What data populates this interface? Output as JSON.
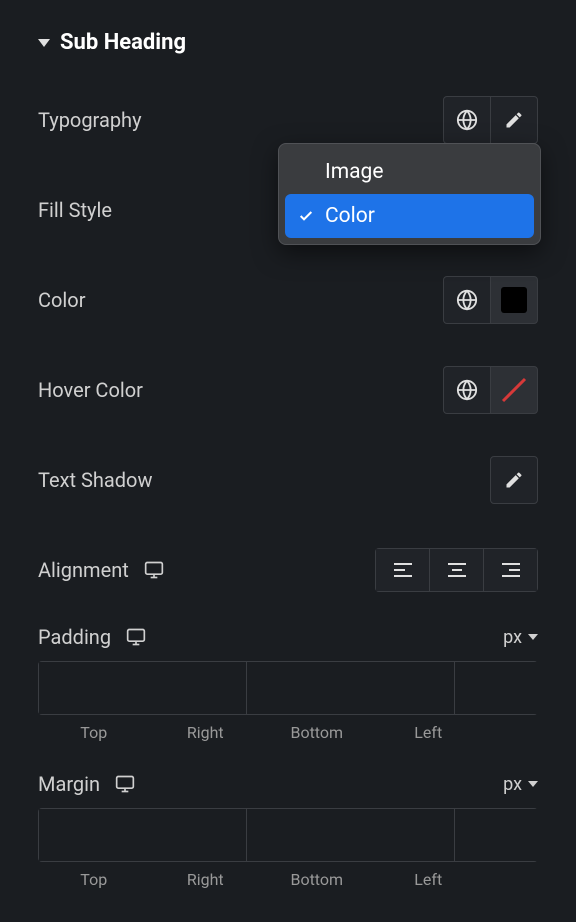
{
  "section": {
    "title": "Sub Heading"
  },
  "rows": {
    "typography": {
      "label": "Typography"
    },
    "fillStyle": {
      "label": "Fill Style"
    },
    "color": {
      "label": "Color"
    },
    "hoverColor": {
      "label": "Hover Color"
    },
    "textShadow": {
      "label": "Text Shadow"
    },
    "alignment": {
      "label": "Alignment"
    }
  },
  "dropdown": {
    "options": [
      {
        "label": "Image",
        "selected": false
      },
      {
        "label": "Color",
        "selected": true
      }
    ]
  },
  "spacing": {
    "padding": {
      "label": "Padding",
      "unit": "px",
      "sides": {
        "top": "Top",
        "right": "Right",
        "bottom": "Bottom",
        "left": "Left"
      }
    },
    "margin": {
      "label": "Margin",
      "unit": "px",
      "sides": {
        "top": "Top",
        "right": "Right",
        "bottom": "Bottom",
        "left": "Left"
      }
    }
  }
}
